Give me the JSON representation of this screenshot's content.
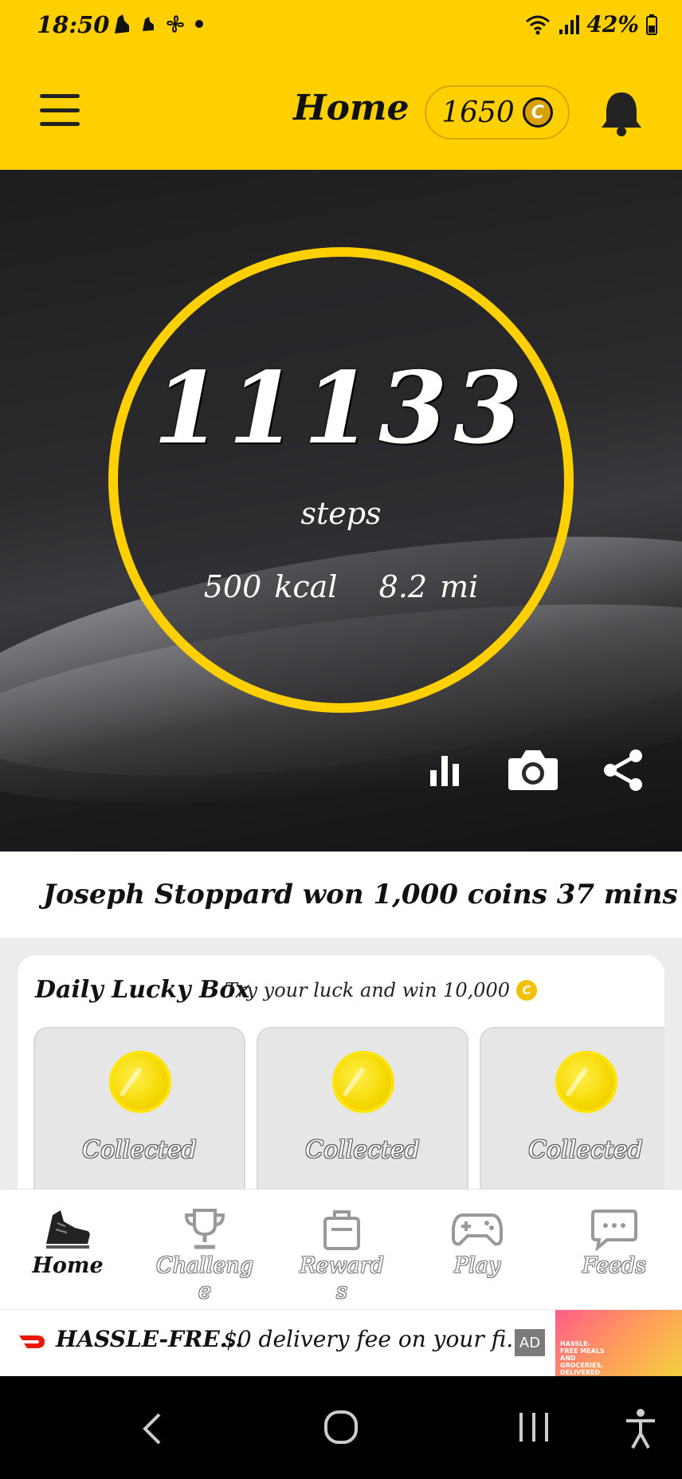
{
  "status_bar": {
    "time": "18:50",
    "battery": "42%"
  },
  "header": {
    "title": "Home",
    "coins": "1650",
    "coin_symbol": "C"
  },
  "hero": {
    "steps": "11133",
    "steps_label": "steps",
    "kcal": "500 kcal",
    "distance": "8.2 mi",
    "ring_color": "#FFD000"
  },
  "ticker": {
    "text": "Joseph Stoppard won 1,000 coins 37 mins ..."
  },
  "lucky_box": {
    "title": "Daily Lucky Box",
    "subtitle": "Try your luck and win 10,000",
    "coin_symbol": "C",
    "boxes": [
      {
        "label": "Collected"
      },
      {
        "label": "Collected"
      },
      {
        "label": "Collected"
      }
    ]
  },
  "bottom_nav": {
    "items": [
      {
        "label": "Home",
        "icon": "sneaker-icon",
        "active": true
      },
      {
        "label": "Challeng\ne",
        "icon": "trophy-icon",
        "active": false
      },
      {
        "label": "Reward\ns",
        "icon": "bag-icon",
        "active": false
      },
      {
        "label": "Play",
        "icon": "gamepad-icon",
        "active": false
      },
      {
        "label": "Feeds",
        "icon": "chat-icon",
        "active": false
      }
    ]
  },
  "ad": {
    "brand": "HASSLE-FRE...",
    "text": "$0 delivery fee on your fi...",
    "badge": "AD",
    "image_text": "HASSLE-FREE MEALS AND GROCERIES, DELIVERED"
  },
  "colors": {
    "accent": "#FFD000",
    "dark": "#111111"
  }
}
